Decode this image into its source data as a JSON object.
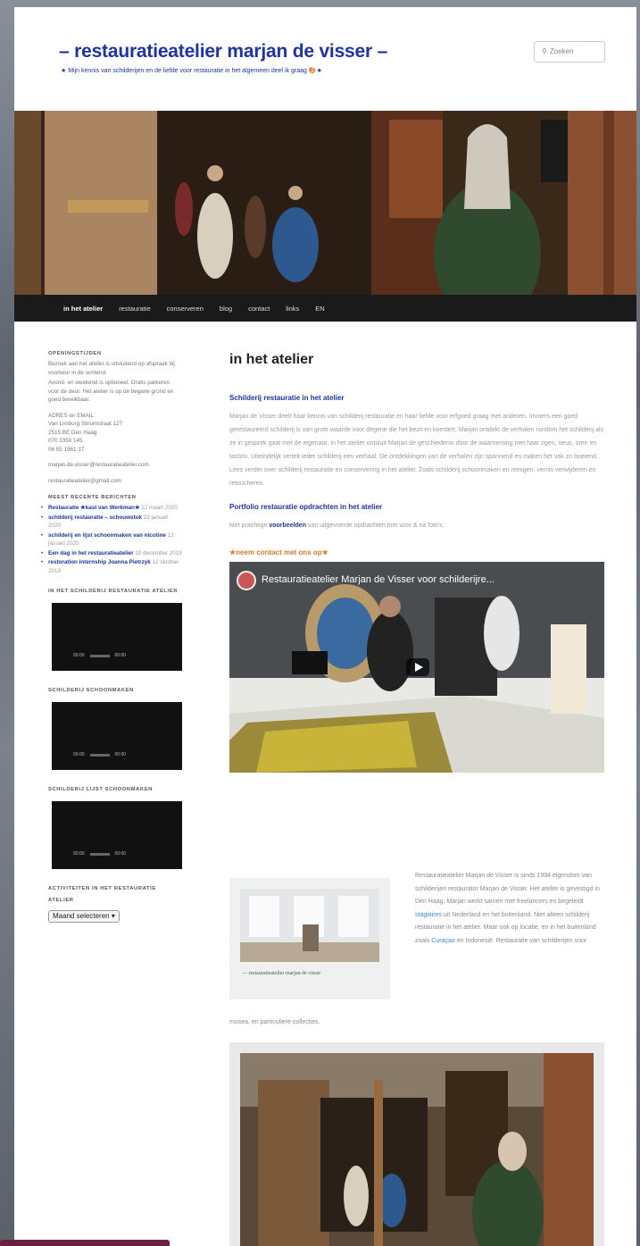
{
  "header": {
    "title": "– restauratieatelier marjan de visser –",
    "tagline": "★ Mijn kennis van schilderijen en de liefde voor restauratie in het algemeen deel ik graag 🎨★",
    "search_placeholder": "Zoeken"
  },
  "nav": {
    "items": [
      "in het atelier",
      "restauratie",
      "conserveren",
      "blog",
      "contact",
      "links",
      "EN"
    ]
  },
  "sidebar": {
    "hours_title": "OPENINGSTIJDEN",
    "hours_text": "Bezoek aan het atelier is uitsluitend op afspraak bij voorkeur in de ochtend.",
    "hours_text2": "Avond- en weekend is optioneel. Gratis parkeren voor de deur.",
    "hours_text3": "Het atelier is op de begane grond en goed bereikbaar.",
    "address_label": "ADRES en EMAIL:",
    "address_line1": "Van Limburg Stirumstraat 127",
    "address_line2": "2515 BE Den Haag",
    "phone1": "070 3350 145",
    "phone2": "06 55 1961 37",
    "email1": "marjan.de.visser@restauratieatelier.com",
    "email2": "restauratieatelier@gmail.com",
    "recent_title": "MEEST RECENTE BERICHTEN",
    "recent": [
      {
        "title": "Restauratie ★kast van Werkman★",
        "date": "12 maart 2020"
      },
      {
        "title": "schilderij restauratie – schouwstuk",
        "date": "23 januari 2020"
      },
      {
        "title": "schilderij en lijst schoonmaken van nicotine",
        "date": "12 januari 2020"
      },
      {
        "title": "Een dag in het restauratieatelier",
        "date": "10 december 2019"
      },
      {
        "title": "restoration internship Joanna Pietrzyk",
        "date": "12 oktober 2019"
      }
    ],
    "video1_title": "IN HET SCHILDERIJ RESTAURATIE ATELIER",
    "video2_title": "SCHILDERIJ SCHOONMAKEN",
    "video3_title": "SCHILDERIJ LIJST SCHOONMAKEN",
    "video_time": "00:00",
    "video_duration": "00:00",
    "archive_title": "ACTIVITEITEN IN HET RESTAURATIE ATELIER",
    "archive_select": "Maand selecteren"
  },
  "main": {
    "title": "in het atelier",
    "sub1": "Schilderij restauratie in het atelier",
    "para1": "Marjan de Visser deelt haar kennis van schilderij restauratie en haar liefde voor erfgoed graag met anderen. Immers een goed gerestaureerd schilderij is van grote waarde voor degene die het bezit en koestert. Marjan ontdekt de verhalen rondom het schilderij als ze in gesprek gaat met de eigenaar. In het atelier ontsluit Marjan de geschiedenis door de waarneming met haar ogen, neus, oren en tastzin. Uiteindelijk vertelt ieder schilderij een verhaal. De ontdekkingen van de verhalen zijn spannend en maken het vak zo boeiend. Lees verder over schilderij restauratie en conservering in het atelier. Zoals schilderij schoonmaken en reinigen, vernis verwijderen en retoucheren.",
    "sub2": "Portfolio restauratie opdrachten in het atelier",
    "para2_pre": "Met prachtige ",
    "para2_link": "voorbeelden",
    "para2_post": " van uitgevoerde opdrachten met voor & na foto's.",
    "contact": "★neem contact met ons op★",
    "video_title": "Restauratieatelier Marjan de Visser voor schilderijre...",
    "figure_caption": "— restauratieatelier marjan de visser",
    "side_text_1": "Restauratieatelier Marjan de Visser is sinds 1994 eigendom van schilderijen restaurator Marjan de Visser. Het atelier is gevestigd in Den Haag. Marjan werkt samen met freelancers en begeleidt ",
    "side_link_1": "stagiaires",
    "side_text_2": " uit Nederland en het buitenland. Niet alleen schilderij restauratie in het atelier. Maar ook op locatie, en in het buitenland zoals ",
    "side_link_2": "Curaçao",
    "side_text_3": " en Indonesië. Restauratie van schilderijen voor",
    "after_text": "musea, en particuliere collecties."
  }
}
